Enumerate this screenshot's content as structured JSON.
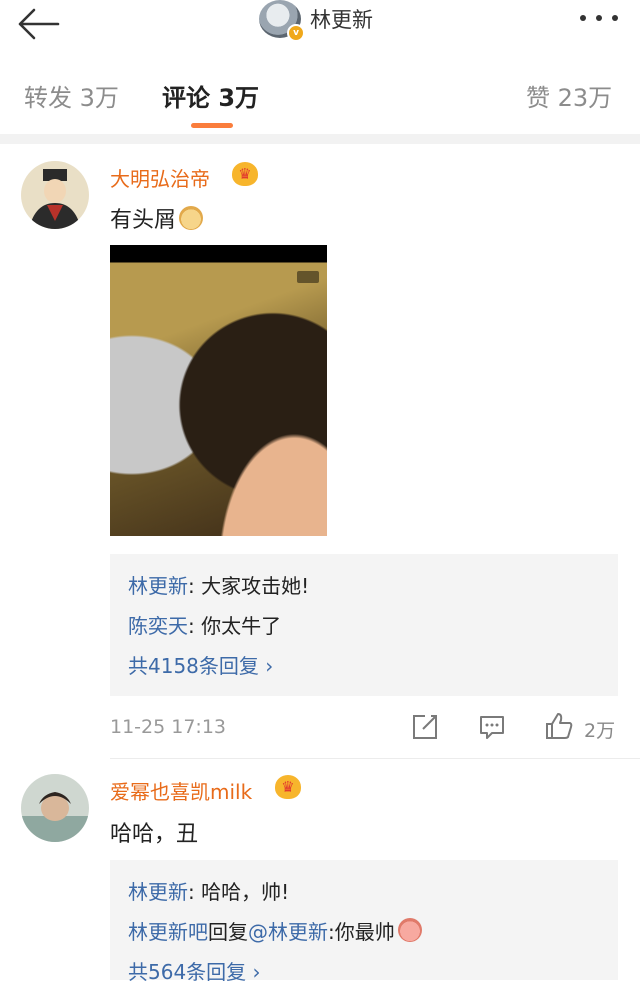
{
  "header": {
    "title": "林更新",
    "verified_badge": "v"
  },
  "tabs": [
    {
      "label": "转发 3万"
    },
    {
      "label": "评论 3万"
    },
    {
      "label": "赞 23万"
    }
  ],
  "comments": [
    {
      "username": "大明弘治帝",
      "vip_badge": "♛",
      "text": "有头屑",
      "replies": [
        {
          "author": "林更新",
          "text": ": 大家攻击她!"
        },
        {
          "author": "陈奕天",
          "text": ": 你太牛了"
        }
      ],
      "reply_count_label": "共4158条回复 ›",
      "time": "11-25 17:13",
      "like_count": "2万"
    },
    {
      "username": "爱幂也喜凯milk",
      "vip_badge": "♛",
      "text": "哈哈，丑",
      "replies": [
        {
          "author": "林更新",
          "text": ": 哈哈，帅!"
        },
        {
          "author": "林更新吧",
          "middle": "回复",
          "mention": "@林更新",
          "text": ":你最帅"
        }
      ],
      "reply_count_label": "共564条回复 ›"
    }
  ],
  "colors": {
    "accent": "#fa7d3c",
    "username": "#e86b1a",
    "link": "#3d6aa8"
  }
}
